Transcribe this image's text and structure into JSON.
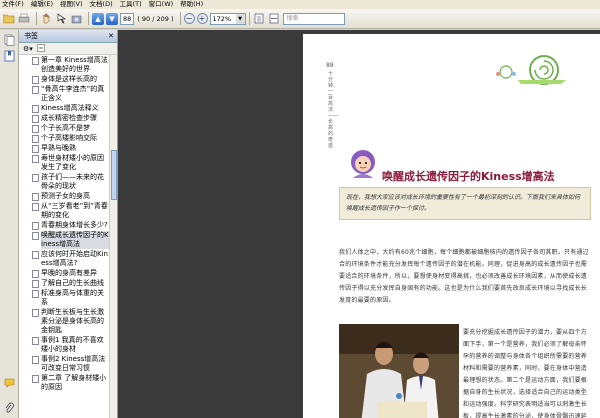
{
  "menu": [
    "文件(F)",
    "编辑(E)",
    "视图(V)",
    "文档(D)",
    "工具(T)",
    "窗口(W)",
    "帮助(H)"
  ],
  "toolbar": {
    "page_current": "88",
    "page_count": "( 90 / 209 )",
    "zoom": "172%",
    "search_placeholder": "搜索"
  },
  "bookmarks": {
    "title": "书签",
    "items": [
      "第一章 Kiness增高法创造美好的世界",
      "身体是这样长高的",
      "“骨高牛李连杰”的真正含义",
      "Kiness增高法释义",
      "成长精密检查步骤",
      "个子长高不是梦",
      "个子高矮影响交际",
      "早熟与晚熟",
      "寿世身材矮小的原因发生了变化",
      "孩子们——未来的花骨朵的现状",
      "预测子女的身高",
      "从“三岁看老”到”青春期的变化",
      "青春期身体增长多少?",
      "唤醒成长遗传因子的Kiness增高法",
      "应该何时开始启动Kiness增高法?",
      "早晚的身高有差异",
      "了解自己的生长曲线",
      "标准身高与体重的关系",
      "判断生长板与生长激素分泌是身体长高的金钥匙",
      "事例1 我真的不喜欢矮小的身材",
      "事例2 Kiness增高法可改变日常习惯",
      "第二章 了解身材矮小的原因"
    ],
    "selected_index": 13
  },
  "page": {
    "page_number": "88",
    "running_title": "十分钟，一百高法——长高的奇迹",
    "headline": "唤醒成长遗传因子的Kiness增高法",
    "intro": "现在，我想大家应该对成长环境的重要性有了一个最初深刻的认识。下面我们来具体如何唤醒成长遗传因子作一个探讨。",
    "para1": "我们人体之中，大约有60兆个细胞，每个细胞都被细胞核内的遗传因子各司其职。只有通过合的环境条件才能充分发挥每个遗传因子的潜在机能。同理，促进身高的成长遗传因子也需要适合的环境条件，所以，要想使身材变得高挑，也必须改善成长环境因素，从而使成长遗传因子得以充分发挥自身固有的功能。这也是为什么我们要首先改良成长环境以寻找成长长发育的最要的原因。",
    "para2": "要充分挖掘成长遗传因子的潜力，要从四个方面下手，第一个是营养，我们必须了解母亲怀孕的营养的调整与身体各个组织所需要的营养材料和需要的营养素，同时，要在身体中营造最理想的状态。第二个是运动方面，我们要根据自身的生长状况，选择适合自己的运动类型和运动强度。科学研究表明适当可以刺激生长板，提高生长激素的分泌，使身体骨骼迅速延长。"
  }
}
